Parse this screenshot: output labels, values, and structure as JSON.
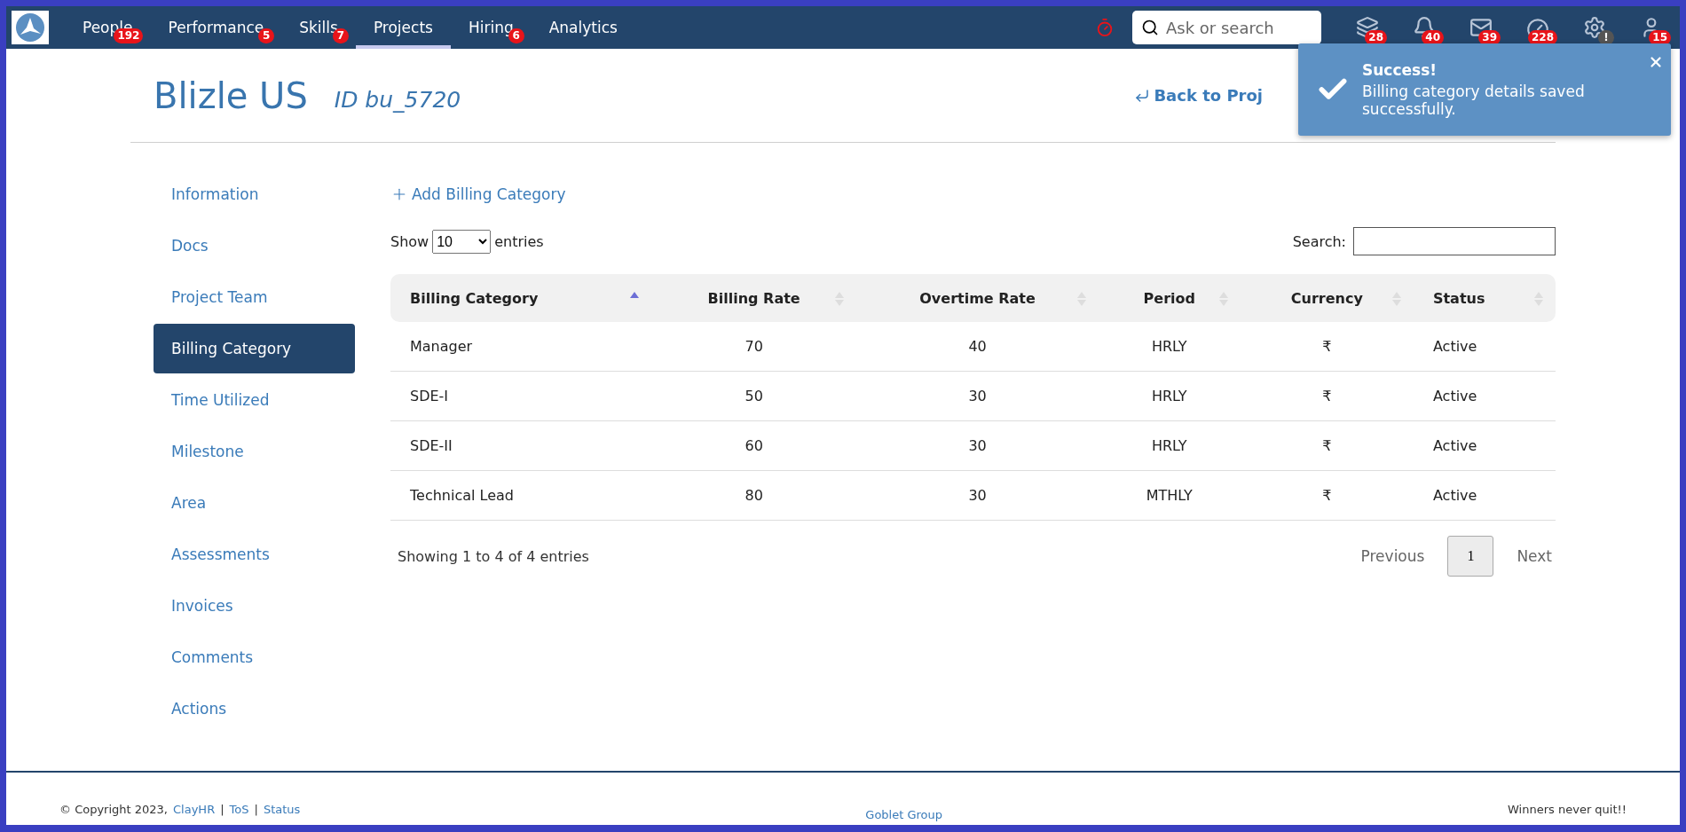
{
  "nav": {
    "items": [
      {
        "label": "People",
        "badge": "192",
        "selected": false
      },
      {
        "label": "Performance",
        "badge": "5",
        "selected": false
      },
      {
        "label": "Skills",
        "badge": "7",
        "selected": false
      },
      {
        "label": "Projects",
        "selected": true
      },
      {
        "label": "Hiring",
        "badge": "6",
        "selected": false
      },
      {
        "label": "Analytics",
        "selected": false
      }
    ],
    "search": {
      "placeholder": "Ask or search"
    },
    "icons": [
      {
        "kind": "stack",
        "badge": "28"
      },
      {
        "kind": "bell",
        "badge": "40"
      },
      {
        "kind": "mail",
        "badge": "39"
      },
      {
        "kind": "gauge",
        "badge": "228"
      },
      {
        "kind": "gear",
        "badge": "!"
      },
      {
        "kind": "avatar",
        "badge": "15"
      }
    ]
  },
  "header": {
    "title": "Blizle US",
    "id": "ID bu_5720",
    "back_link": "Back to Proj"
  },
  "toast": {
    "title": "Success!",
    "message": "Billing category details saved successfully."
  },
  "sidebar": {
    "items": [
      {
        "label": "Information",
        "selected": false
      },
      {
        "label": "Docs",
        "selected": false
      },
      {
        "label": "Project Team",
        "selected": false
      },
      {
        "label": "Billing Category",
        "selected": true
      },
      {
        "label": "Time Utilized",
        "selected": false
      },
      {
        "label": "Milestone",
        "selected": false
      },
      {
        "label": "Area",
        "selected": false
      },
      {
        "label": "Assessments",
        "selected": false
      },
      {
        "label": "Invoices",
        "selected": false
      },
      {
        "label": "Comments",
        "selected": false
      },
      {
        "label": "Actions",
        "selected": false
      }
    ]
  },
  "add_link": "Add Billing Category",
  "table": {
    "show_label": "Show",
    "page_size": "10",
    "entries_label": "entries",
    "search_label": "Search:",
    "columns": [
      {
        "label": "Billing Category",
        "sorted": true
      },
      {
        "label": "Billing Rate",
        "sorted": false
      },
      {
        "label": "Overtime Rate",
        "sorted": false
      },
      {
        "label": "Period",
        "sorted": false
      },
      {
        "label": "Currency",
        "sorted": false
      },
      {
        "label": "Status",
        "sorted": false
      }
    ],
    "rows": [
      [
        "Manager",
        "70",
        "40",
        "HRLY",
        "₹",
        "Active"
      ],
      [
        "SDE-I",
        "50",
        "30",
        "HRLY",
        "₹",
        "Active"
      ],
      [
        "SDE-II",
        "60",
        "30",
        "HRLY",
        "₹",
        "Active"
      ],
      [
        "Technical Lead",
        "80",
        "30",
        "MTHLY",
        "₹",
        "Active"
      ]
    ],
    "info": "Showing 1 to 4 of 4 entries",
    "pagination": {
      "previous": "Previous",
      "pages": [
        {
          "label": "1",
          "selected": true
        }
      ],
      "next": "Next"
    }
  },
  "footer": {
    "copyright": "© Copyright 2023,",
    "brand_link": "ClayHR",
    "sep1": "|",
    "tos": "ToS",
    "sep2": "|",
    "status": "Status",
    "center": "Goblet Group",
    "motto": "Winners never quit!!"
  }
}
